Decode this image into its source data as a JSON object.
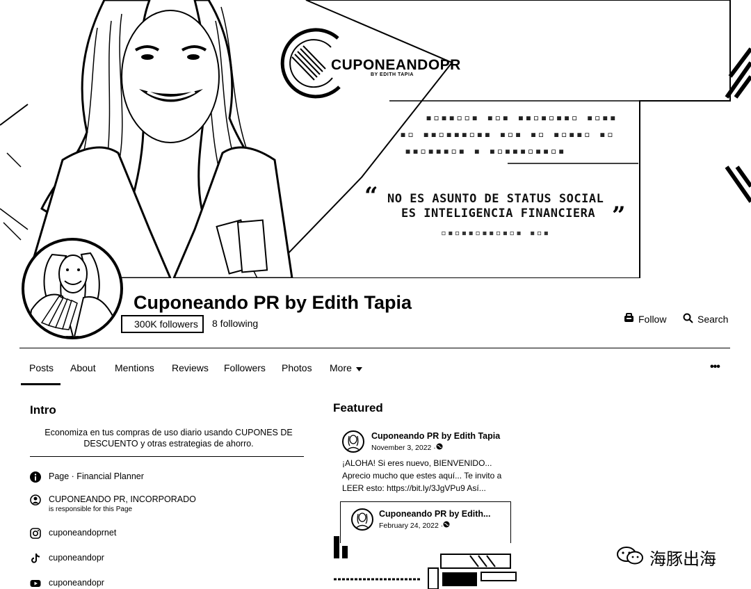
{
  "cover": {
    "brand_name": "CUPONEANDOPR",
    "brand_sub": "BY EDITH TAPIA",
    "quote_line_1": "NO ES ASUNTO DE STATUS SOCIAL",
    "quote_line_2": "ES INTELIGENCIA FINANCIERA"
  },
  "header": {
    "page_name": "Cuponeando PR by Edith Tapia",
    "followers": "300K followers",
    "following": "8 following",
    "follow_label": "Follow",
    "search_label": "Search"
  },
  "tabs": [
    {
      "label": "Posts"
    },
    {
      "label": "About"
    },
    {
      "label": "Mentions"
    },
    {
      "label": "Reviews"
    },
    {
      "label": "Followers"
    },
    {
      "label": "Photos"
    },
    {
      "label": "More"
    }
  ],
  "more_icon": "chevron-down-icon",
  "options_icon": "more-options-icon",
  "intro": {
    "title": "Intro",
    "description": "Economiza en tus compras de uso diario usando CUPONES DE DESCUENTO y otras estrategias de ahorro.",
    "rows": [
      {
        "icon": "info-icon",
        "label": "Page",
        "detail": " · Financial Planner"
      },
      {
        "icon": "responsible-icon",
        "label": "CUPONEANDO PR, INCORPORADO",
        "sub": "is responsible for this Page"
      },
      {
        "icon": "instagram-icon",
        "label": "cuponeandoprnet"
      },
      {
        "icon": "tiktok-icon",
        "label": "cuponeandopr"
      },
      {
        "icon": "youtube-icon",
        "label": "cuponeandopr"
      }
    ]
  },
  "featured": {
    "title": "Featured",
    "post": {
      "author": "Cuponeando PR by Edith Tapia",
      "date": "November 3, 2022 · ",
      "text": "¡ALOHA! Si eres nuevo, BIENVENIDO... Aprecio mucho que estes aquí... Te invito a LEER esto: https://bit.ly/3JgVPu9 Así..."
    },
    "shared": {
      "author": "Cuponeando PR by Edith...",
      "date": "February 24, 2022 · "
    }
  },
  "watermark": "海豚出海"
}
